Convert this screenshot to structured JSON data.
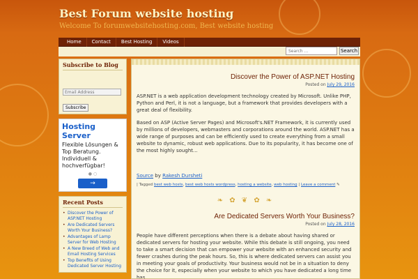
{
  "site": {
    "title": "Best Forum website hosting",
    "tagline": "Welcome To forumwebsitehosting.com, Best website hosting"
  },
  "nav": {
    "items": [
      "Home",
      "Contact",
      "Best Hosting",
      "Videos"
    ]
  },
  "search": {
    "placeholder": "Search ...",
    "button_label": "Search"
  },
  "sidebar": {
    "subscribe": {
      "title": "Subscribe to Blog",
      "email_placeholder": "Email Address",
      "button_label": "Subscribe"
    },
    "ad": {
      "title": "Hosting Server",
      "body": "Flexible Lösungen & Top Beratung. Individuell & hochverfügbar!",
      "dots": "● ○",
      "button_icon": "arrow-right-icon"
    },
    "recent_posts": {
      "title": "Recent Posts",
      "items": [
        "Discover the Power of ASP.NET Hosting",
        "Are Dedicated Servers Worth Your Business?",
        "Advantages of Lamp Server for Web Hosting",
        "A New Breed of Web and Email Hosting Services",
        "Top Benefits of Using Dedicated Server Hosting"
      ]
    }
  },
  "posts": [
    {
      "title": "Discover the Power of ASP.NET Hosting",
      "posted_on": "Posted on",
      "date": "July 29, 2016",
      "paragraphs": [
        "ASP.NET is a web application development technology created by Microsoft. Unlike PHP, Python and Perl, it is not a language, but a framework that provides developers with a great deal of flexibility.",
        "Based on ASP (Active Server Pages) and Microsoft's.NET Framework, it is currently used by millions of developers, webmasters and corporations around the world. ASP.NET has a wide range of purposes and can be efficiently used to create everything from a small website to dynamic, robust web applications. Due to its popularity, it has become one of the most highly sought..."
      ],
      "source_label": "Source",
      "by": "by",
      "author": "Rakesh Dursheti",
      "tagged_label": "| Tagged",
      "tags": [
        "best web hosts",
        "best web hosts wordpress",
        "hosting a website",
        "web hosting"
      ],
      "comment_link": "Leave a comment"
    },
    {
      "title": "Are Dedicated Servers Worth Your Business?",
      "posted_on": "Posted on",
      "date": "July 28, 2016",
      "paragraphs": [
        "People have different perceptions when there is a debate about having shared or dedicated servers for hosting your website. While this debate is still ongoing, you need to take a smart decision that can empower your website with an enhanced security and fewer crashes during the peak hours. So, this is where dedicated servers can assist you in meeting your goals of productivity. Your business would not be in a situation to deny the choice for it, especially when your website to which you have dedicated a long time has"
      ]
    }
  ],
  "colors": {
    "header_bg": "#c8560c",
    "nav_bg": "#6e2206",
    "link": "#1a5fc9",
    "title": "#6e2206"
  }
}
